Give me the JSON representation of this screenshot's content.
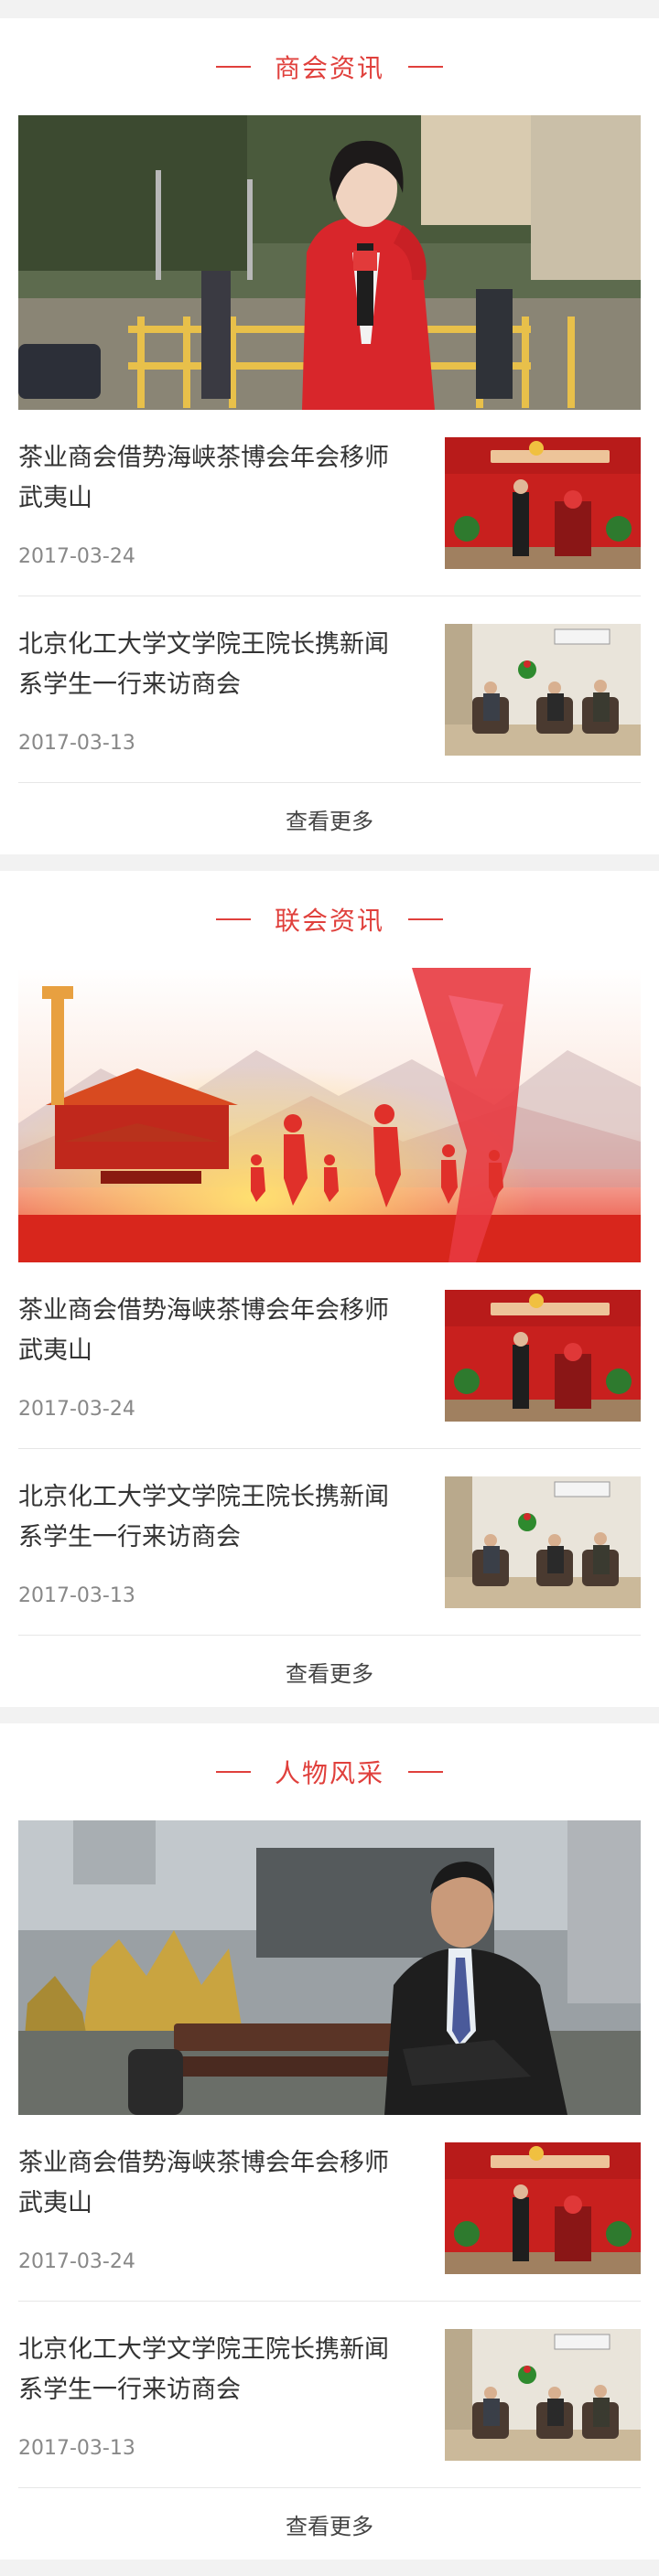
{
  "more_label": "查看更多",
  "sections": [
    {
      "title": "商会资讯",
      "items": [
        {
          "title": "茶业商会借势海峡茶博会年会移师武夷山",
          "date": "2017-03-24"
        },
        {
          "title": "北京化工大学文学院王院长携新闻系学生一行来访商会",
          "date": "2017-03-13"
        }
      ]
    },
    {
      "title": "联会资讯",
      "items": [
        {
          "title": "茶业商会借势海峡茶博会年会移师武夷山",
          "date": "2017-03-24"
        },
        {
          "title": "北京化工大学文学院王院长携新闻系学生一行来访商会",
          "date": "2017-03-13"
        }
      ]
    },
    {
      "title": "人物风采",
      "items": [
        {
          "title": "茶业商会借势海峡茶博会年会移师武夷山",
          "date": "2017-03-24"
        },
        {
          "title": "北京化工大学文学院王院长携新闻系学生一行来访商会",
          "date": "2017-03-13"
        }
      ]
    }
  ],
  "colors": {
    "accent": "#e0403c",
    "text": "#333333",
    "date": "#888888",
    "background": "#f2f2f2"
  }
}
